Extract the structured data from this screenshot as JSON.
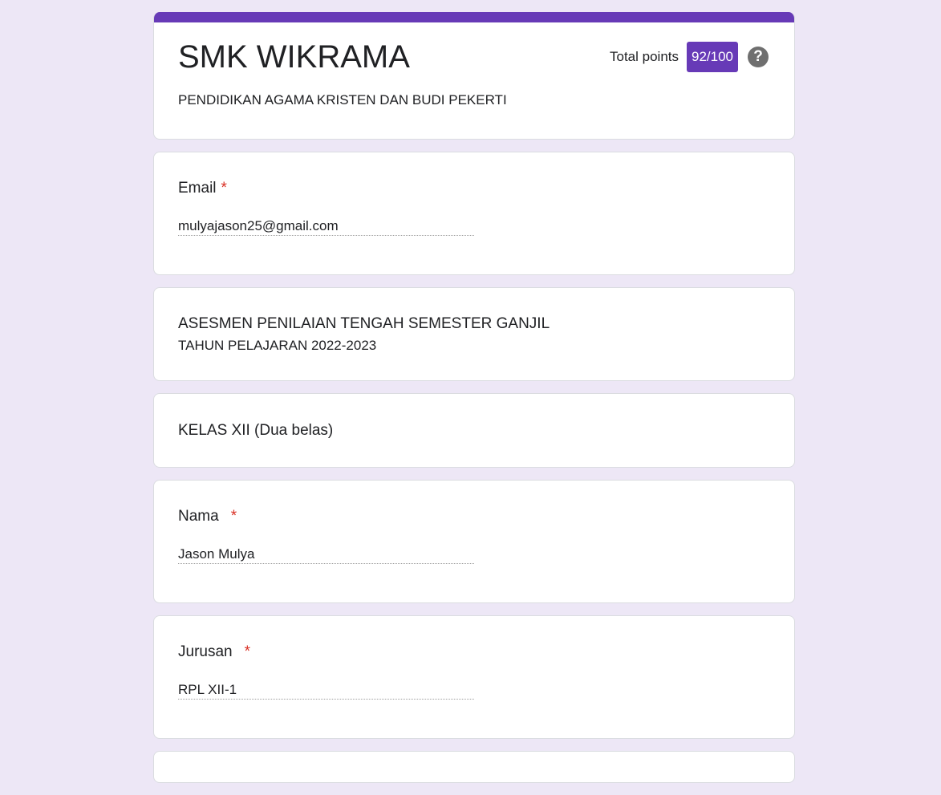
{
  "header": {
    "title": "SMK WIKRAMA",
    "description": "PENDIDIKAN AGAMA KRISTEN DAN BUDI PEKERTI",
    "points_label": "Total points",
    "points_value": "92/100",
    "help_glyph": "?",
    "accent_color": "#673ab7"
  },
  "email": {
    "label": "Email",
    "required_mark": "*",
    "value": "mulyajason25@gmail.com"
  },
  "section": {
    "title": "ASESMEN PENILAIAN TENGAH SEMESTER GANJIL",
    "subtitle": "TAHUN PELAJARAN 2022-2023"
  },
  "class_info": {
    "title": "KELAS XII (Dua belas)"
  },
  "name": {
    "label": "Nama",
    "required_mark": "*",
    "value": "Jason Mulya"
  },
  "major": {
    "label": "Jurusan",
    "required_mark": "*",
    "value": "RPL XII-1"
  },
  "colors": {
    "background": "#ede7f6",
    "required": "#d93025"
  }
}
